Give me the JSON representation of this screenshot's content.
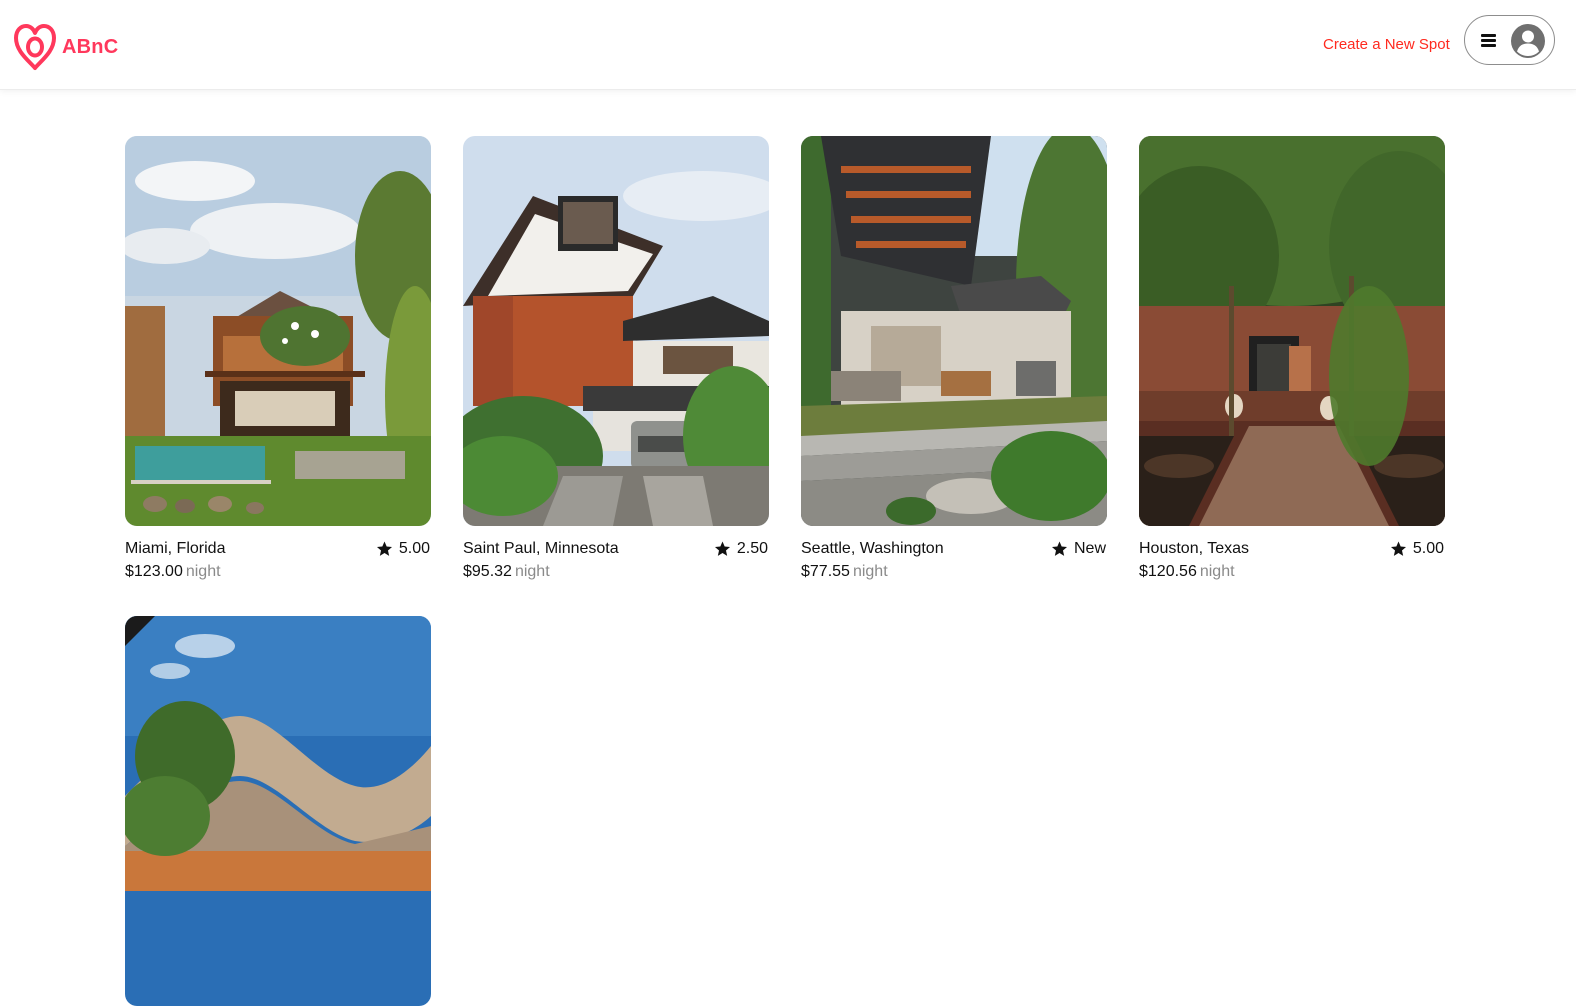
{
  "header": {
    "brand": "ABnC",
    "create_link": "Create a New Spot",
    "icons": {
      "logo": "heart-logo-icon",
      "menu": "hamburger-menu-icon",
      "profile": "user-avatar-icon"
    }
  },
  "colors": {
    "brand": "#ff385c",
    "link": "#ff2a1f",
    "muted": "#8a8a8a"
  },
  "spots": [
    {
      "city": "Miami, Florida",
      "rating": "5.00",
      "price": "$123.00",
      "unit": "night",
      "image": "tropical-villa-with-pool"
    },
    {
      "city": "Saint Paul, Minnesota",
      "rating": "2.50",
      "price": "$95.32",
      "unit": "night",
      "image": "modern-house-with-carport"
    },
    {
      "city": "Seattle, Washington",
      "rating": "New",
      "price": "$77.55",
      "unit": "night",
      "image": "open-patio-with-steel-pergola"
    },
    {
      "city": "Houston, Texas",
      "rating": "5.00",
      "price": "$120.56",
      "unit": "night",
      "image": "brick-courtyard-with-trees"
    },
    {
      "image": "curved-roof-modern-house"
    }
  ]
}
